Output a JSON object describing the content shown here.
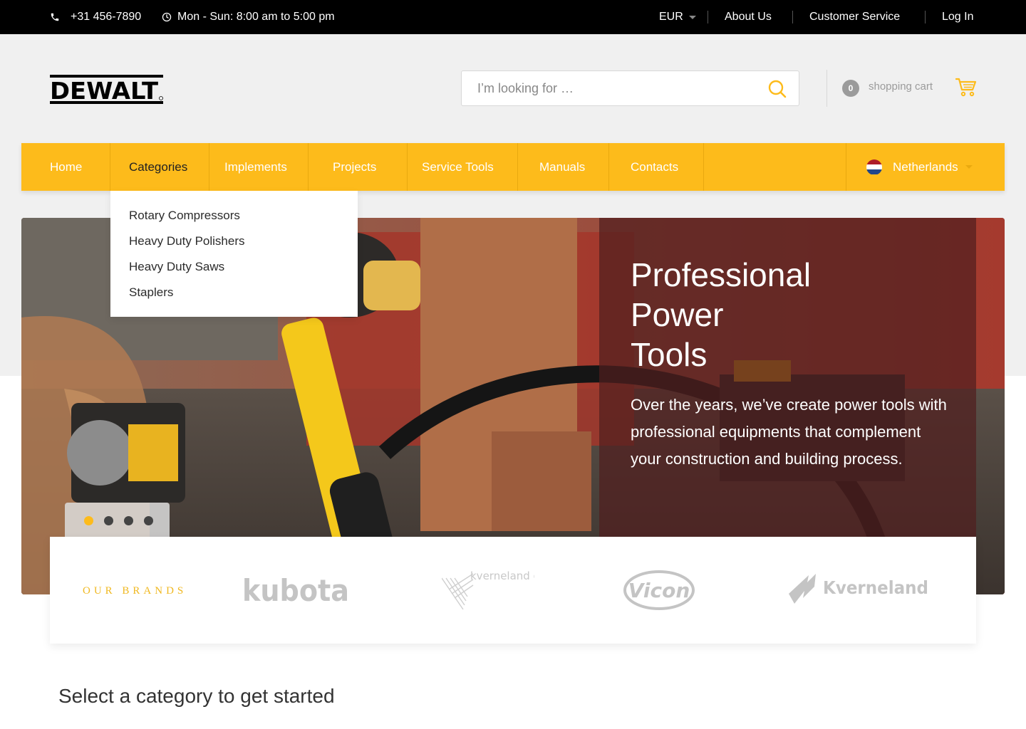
{
  "topbar": {
    "phone": "+31 456-7890",
    "hours": "Mon - Sun: 8:00 am to 5:00 pm",
    "currency": "EUR",
    "links": [
      "About Us",
      "Customer Service",
      "Log In"
    ]
  },
  "header": {
    "logo_text": "DEWALT",
    "search_placeholder": "I’m looking for …",
    "cart_count": "0",
    "cart_label": "shopping cart"
  },
  "nav": {
    "items": [
      "Home",
      "Categories",
      "Implements",
      "Projects",
      "Service Tools",
      "Manuals",
      "Contacts"
    ],
    "active": "Categories",
    "country": "Netherlands"
  },
  "dropdown": {
    "items": [
      "Rotary Compressors",
      "Heavy Duty Polishers",
      "Heavy Duty Saws",
      "Staplers"
    ]
  },
  "hero": {
    "title": "Professional\nPower\nTools",
    "text": "Over the years, we’ve create power tools with professional equipments that complement your construction and building process.",
    "slides": 4,
    "active_slide": 1
  },
  "brands": {
    "label": "OUR BRANDS",
    "items": [
      "kubota",
      "kverneland group",
      "Vicon",
      "Kverneland"
    ]
  },
  "section": {
    "title": "Select a category to get started"
  },
  "colors": {
    "accent": "#fdbb1b",
    "topbar": "#000000",
    "header_bg": "#f0f0f0"
  }
}
